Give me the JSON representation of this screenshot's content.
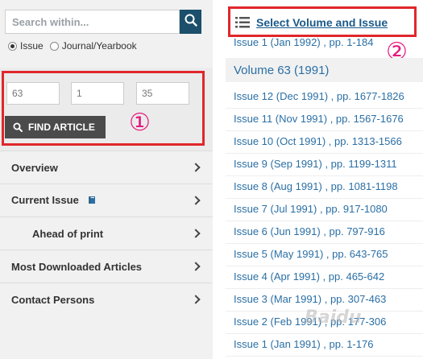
{
  "search": {
    "placeholder": "Search within..."
  },
  "radio": {
    "issue_label": "Issue",
    "journal_label": "Journal/Yearbook"
  },
  "find": {
    "volume": "63",
    "issue": "1",
    "page": "35",
    "button_label": "FIND ARTICLE"
  },
  "annotations": {
    "one": "①",
    "two": "②"
  },
  "menu": {
    "overview": "Overview",
    "current_issue": "Current Issue",
    "ahead_of_print": "Ahead of print",
    "most_downloaded": "Most Downloaded Articles",
    "contact": "Contact Persons"
  },
  "right": {
    "select_label": "Select Volume and Issue",
    "partial_issue": "Issue 1 (Jan 1992) , pp. 1-184",
    "volume_title": "Volume 63 (1991)",
    "issues": [
      "Issue 12 (Dec 1991) , pp. 1677-1826",
      "Issue 11 (Nov 1991) , pp. 1567-1676",
      "Issue 10 (Oct 1991) , pp. 1313-1566",
      "Issue 9 (Sep 1991) , pp. 1199-1311",
      "Issue 8 (Aug 1991) , pp. 1081-1198",
      "Issue 7 (Jul 1991) , pp. 917-1080",
      "Issue 6 (Jun 1991) , pp. 797-916",
      "Issue 5 (May 1991) , pp. 643-765",
      "Issue 4 (Apr 1991) , pp. 465-642",
      "Issue 3 (Mar 1991) , pp. 307-463",
      "Issue 2 (Feb 1991) , pp. 177-306",
      "Issue 1 (Jan 1991) , pp. 1-176"
    ]
  },
  "watermark": "Baidu",
  "colors": {
    "accent": "#1b4f6b",
    "link": "#2a6fa5",
    "highlight": "#e0272b",
    "annotation": "#e5197f"
  }
}
